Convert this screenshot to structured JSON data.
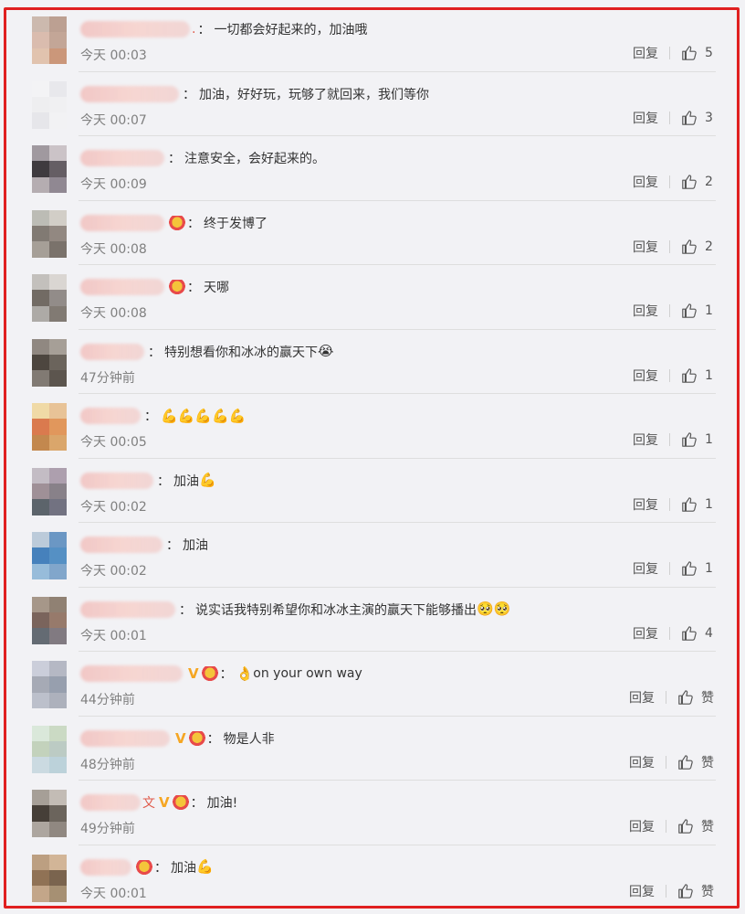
{
  "ui": {
    "reply_label": "回复",
    "like_label": "赞",
    "like_icon": "thumbs-up-icon"
  },
  "comments": [
    {
      "text": "一切都会好起来的，加油哦",
      "time": "今天 00:03",
      "likes": "5",
      "nameW": 120,
      "badge": false,
      "v": false,
      "prefix": ".",
      "emoji": ""
    },
    {
      "text": "加油，好好玩，玩够了就回来，我们等你",
      "time": "今天 00:07",
      "likes": "3",
      "nameW": 108,
      "badge": false,
      "v": false,
      "prefix": "",
      "emoji": ""
    },
    {
      "text": "注意安全，会好起来的。",
      "time": "今天 00:09",
      "likes": "2",
      "nameW": 92,
      "badge": false,
      "v": false,
      "prefix": "",
      "emoji": ""
    },
    {
      "text": "终于发博了",
      "time": "今天 00:08",
      "likes": "2",
      "nameW": 92,
      "badge": true,
      "v": false,
      "prefix": "",
      "emoji": ""
    },
    {
      "text": "天哪",
      "time": "今天 00:08",
      "likes": "1",
      "nameW": 92,
      "badge": true,
      "v": false,
      "prefix": "",
      "emoji": ""
    },
    {
      "text": "特别想看你和冰冰的赢天下",
      "time": "47分钟前",
      "likes": "1",
      "nameW": 70,
      "badge": false,
      "v": false,
      "prefix": "",
      "emoji": "😭"
    },
    {
      "text": "",
      "time": "今天 00:05",
      "likes": "1",
      "nameW": 66,
      "badge": false,
      "v": false,
      "prefix": "",
      "emoji": "💪💪💪💪💪"
    },
    {
      "text": "加油",
      "time": "今天 00:02",
      "likes": "1",
      "nameW": 80,
      "badge": false,
      "v": false,
      "prefix": "",
      "emoji": "💪"
    },
    {
      "text": "加油",
      "time": "今天 00:02",
      "likes": "1",
      "nameW": 90,
      "badge": false,
      "v": false,
      "prefix": "",
      "emoji": ""
    },
    {
      "text": "说实话我特别希望你和冰冰主演的赢天下能够播出",
      "time": "今天 00:01",
      "likes": "4",
      "nameW": 104,
      "badge": false,
      "v": false,
      "prefix": "",
      "emoji": "🥺🥺"
    },
    {
      "text": "on your own way",
      "time": "44分钟前",
      "likes": "赞",
      "nameW": 112,
      "badge": true,
      "v": true,
      "prefix": "",
      "emoji": "👌"
    },
    {
      "text": "物是人非",
      "time": "48分钟前",
      "likes": "赞",
      "nameW": 98,
      "badge": true,
      "v": true,
      "prefix": "",
      "emoji": ""
    },
    {
      "text": "加油!",
      "time": "49分钟前",
      "likes": "赞",
      "nameW": 66,
      "badge": true,
      "v": true,
      "prefix": "文",
      "emoji": ""
    },
    {
      "text": "加油",
      "time": "今天 00:01",
      "likes": "赞",
      "nameW": 56,
      "badge": true,
      "v": false,
      "prefix": "",
      "emoji": "💪"
    }
  ]
}
